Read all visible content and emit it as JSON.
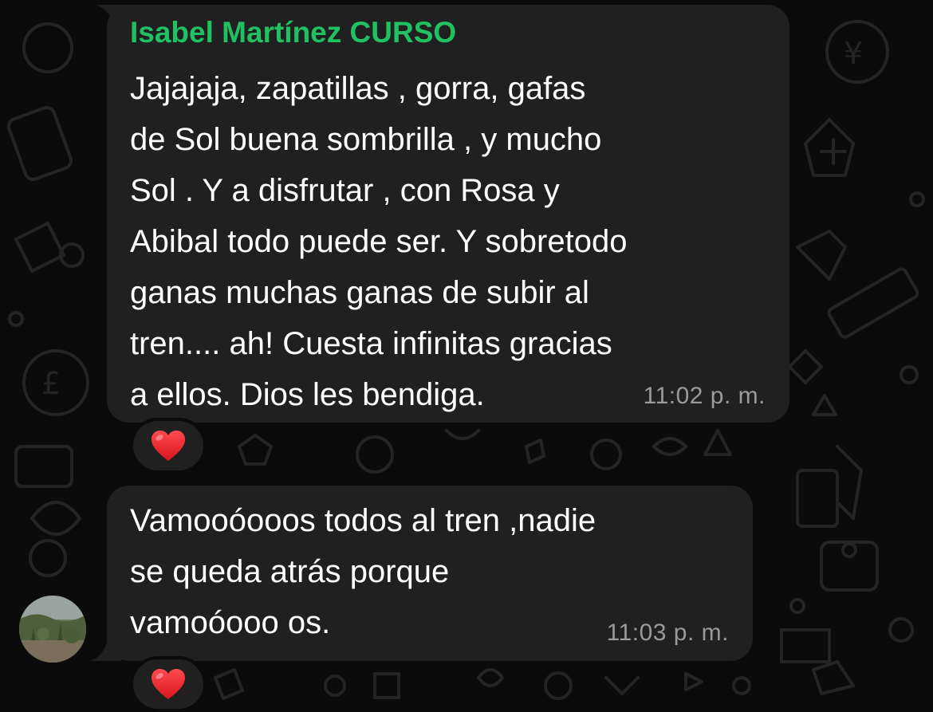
{
  "messages": [
    {
      "sender": "Isabel Martínez CURSO",
      "text": "Jajajaja, zapatillas , gorra,  gafas\nde Sol buena sombrilla , y mucho\nSol . Y a disfrutar , con Rosa y\nAbibal todo puede ser. Y sobretodo\nganas muchas ganas de subir al\ntren.... ah! Cuesta infinitas gracias\na ellos. Dios les bendiga.",
      "time": "11:02 p. m.",
      "reaction": "heart-emoji"
    },
    {
      "text": "Vamooóooos todos al tren ,nadie\nse queda atrás porque\nvamoóooo os.",
      "time": "11:03 p. m.",
      "reaction": "heart-emoji"
    }
  ],
  "colors": {
    "background": "#0b0b0b",
    "bubble": "#202020",
    "sender_name": "#21c063",
    "timestamp": "#9a9a9a",
    "heart": "#e0242b"
  }
}
